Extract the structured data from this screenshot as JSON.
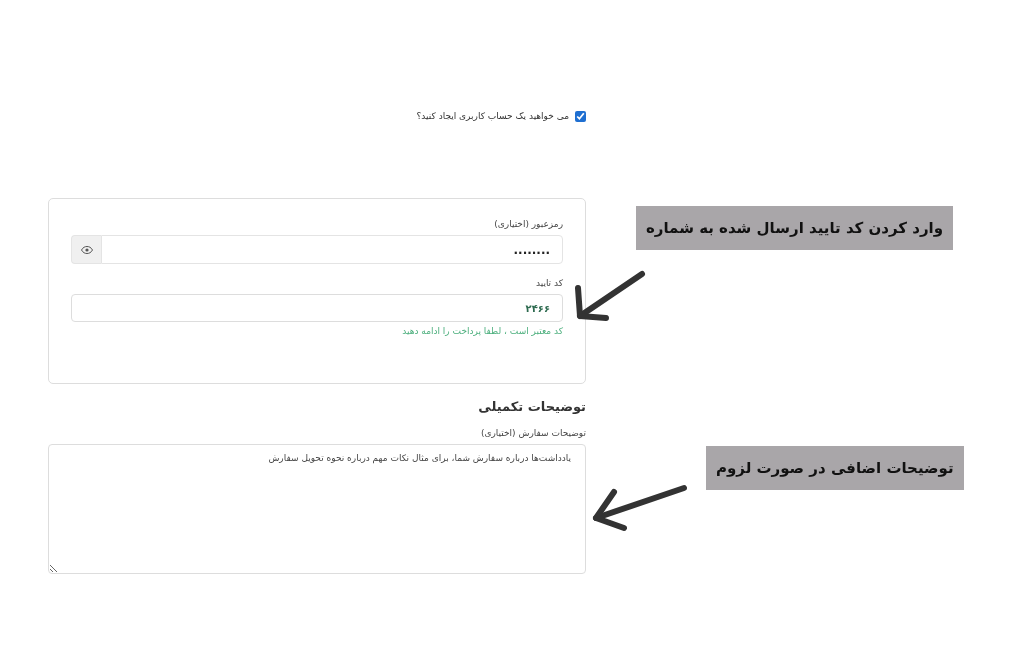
{
  "account_option": {
    "label": "می خواهید یک حساب کاربری ایجاد کنید؟",
    "checked": true
  },
  "verification_card": {
    "password_field": {
      "label": "رمزعبور (اختیاری)",
      "value": "........"
    },
    "code_field": {
      "label": "کد تایید",
      "value": "۲۴۶۶"
    },
    "success_message": "کد معتبر است ، لطفا پرداخت را ادامه دهید"
  },
  "additional_info": {
    "heading": "توضیحات تکمیلی",
    "notes_field": {
      "label": "توضیحات سفارش (اختیاری)",
      "placeholder": "یادداشت‌ها درباره سفارش شما، برای مثال نکات مهم درباره نحوه تحویل سفارش"
    }
  },
  "callouts": [
    {
      "text": "وارد کردن کد تایید ارسال شده به شماره"
    },
    {
      "text": "توضیحات اضافی در صورت لزوم"
    }
  ]
}
